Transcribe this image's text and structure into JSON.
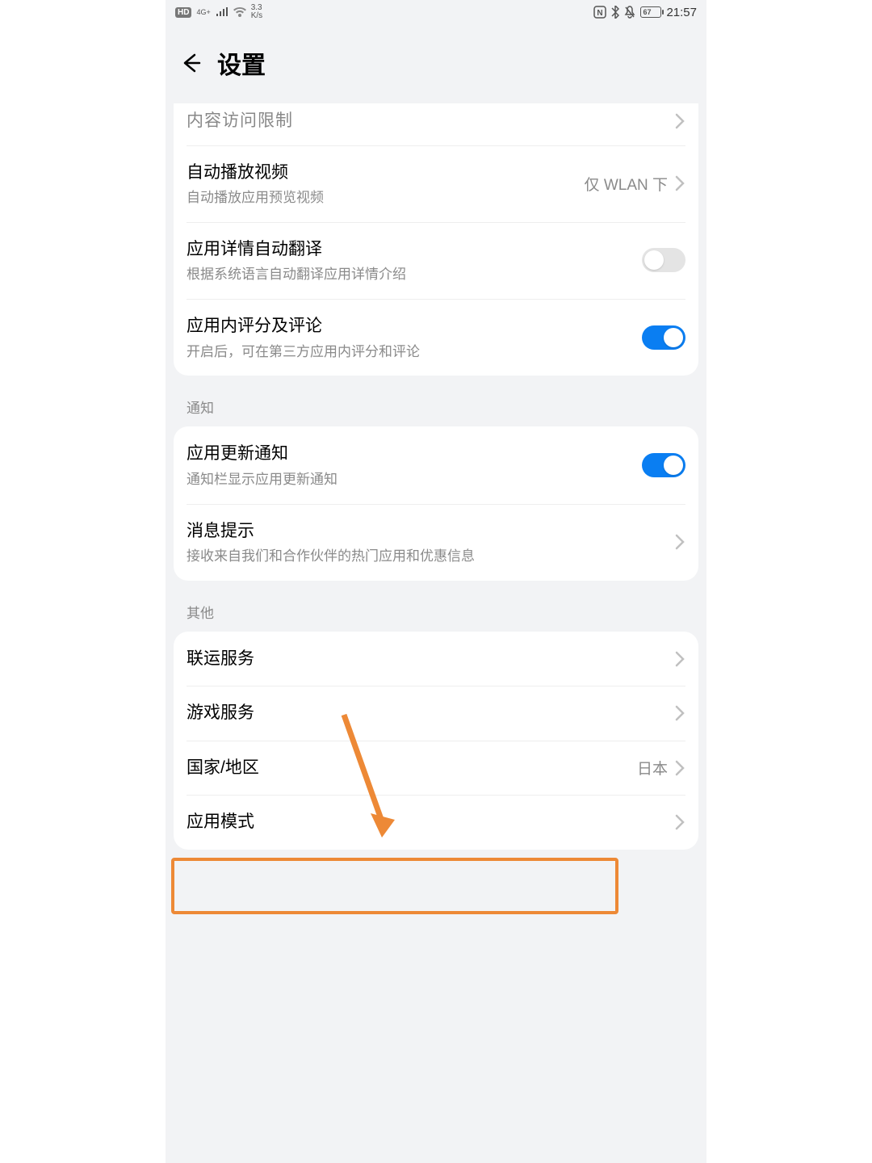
{
  "status": {
    "hd": "HD",
    "network_gen": "4G+",
    "speed_top": "3.3",
    "speed_unit": "K/s",
    "battery": "67",
    "time": "21:57"
  },
  "header": {
    "title": "设置"
  },
  "group1": {
    "content_restriction": "内容访问限制",
    "autoplay_title": "自动播放视频",
    "autoplay_sub": "自动播放应用预览视频",
    "autoplay_value": "仅 WLAN 下",
    "autotranslate_title": "应用详情自动翻译",
    "autotranslate_sub": "根据系统语言自动翻译应用详情介绍",
    "inapp_rating_title": "应用内评分及评论",
    "inapp_rating_sub": "开启后，可在第三方应用内评分和评论"
  },
  "section_notify": "通知",
  "group2": {
    "update_notify_title": "应用更新通知",
    "update_notify_sub": "通知栏显示应用更新通知",
    "msg_prompt_title": "消息提示",
    "msg_prompt_sub": "接收来自我们和合作伙伴的热门应用和优惠信息"
  },
  "section_other": "其他",
  "group3": {
    "joint_service": "联运服务",
    "game_service": "游戏服务",
    "region_title": "国家/地区",
    "region_value": "日本",
    "app_mode": "应用模式"
  }
}
